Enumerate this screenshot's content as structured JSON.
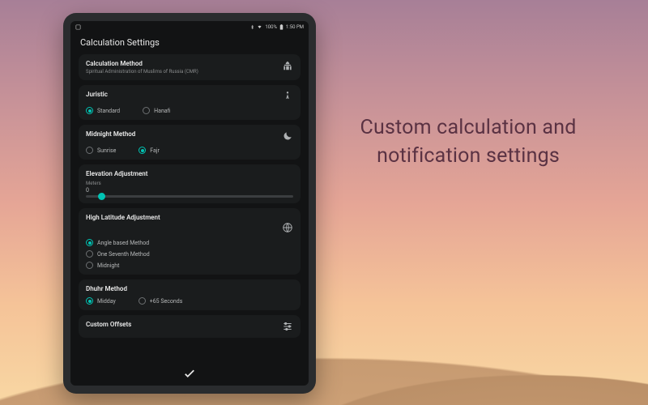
{
  "marketing_heading": "Custom calculation and notification settings",
  "statusbar": {
    "left_icon": "notification-icon",
    "battery_text": "100%",
    "time": "1:50 PM"
  },
  "page_title": "Calculation Settings",
  "cards": {
    "calc_method": {
      "title": "Calculation Method",
      "subtitle": "Spiritual Administration of Muslims of Russia (СМR)"
    },
    "juristic": {
      "title": "Juristic",
      "options": [
        "Standard",
        "Hanafi"
      ],
      "selected": 0
    },
    "midnight": {
      "title": "Midnight Method",
      "options": [
        "Sunrise",
        "Fajr"
      ],
      "selected": 1
    },
    "elevation": {
      "title": "Elevation Adjustment",
      "label": "Meters",
      "value": "0"
    },
    "high_latitude": {
      "title": "High Latitude Adjustment",
      "options": [
        "Angle based Method",
        "One Seventh Method",
        "Midnight"
      ],
      "selected": 0
    },
    "dhuhr": {
      "title": "Dhuhr Method",
      "options": [
        "Midday",
        "+65 Seconds"
      ],
      "selected": 0
    },
    "custom_offsets": {
      "title": "Custom Offsets"
    }
  },
  "colors": {
    "accent": "#00c4b4",
    "heading_color": "#5a3243"
  }
}
